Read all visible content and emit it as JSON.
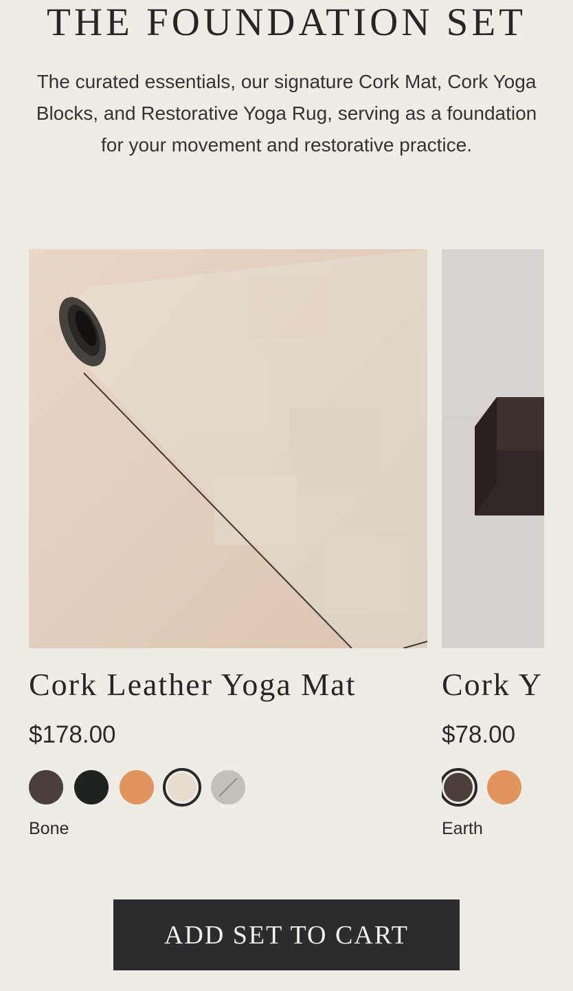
{
  "section": {
    "title": "THE FOUNDATION SET",
    "description": "The curated essentials, our signature Cork Mat, Cork Yoga Blocks, and Restorative Yoga Rug, serving as a foundation for your movement and restorative practice."
  },
  "products": [
    {
      "name": "Cork Leather Yoga Mat",
      "price": "$178.00",
      "selected_color": "Bone",
      "swatches": [
        {
          "name": "dark-brown",
          "color": "#4a3f3b"
        },
        {
          "name": "black",
          "color": "#1e231f"
        },
        {
          "name": "natural-cork",
          "color": "#e2945e"
        },
        {
          "name": "bone",
          "color": "#e7dccd",
          "selected": true
        },
        {
          "name": "grey",
          "color": "#c3c0b7"
        }
      ]
    },
    {
      "name": "Cork Y",
      "price": "$78.00",
      "selected_color": "Earth",
      "swatches": [
        {
          "name": "earth",
          "color": "#4a3f3b",
          "selected": true
        },
        {
          "name": "natural-cork",
          "color": "#e2945e"
        }
      ]
    }
  ],
  "cta": {
    "label": "ADD SET TO CART"
  }
}
